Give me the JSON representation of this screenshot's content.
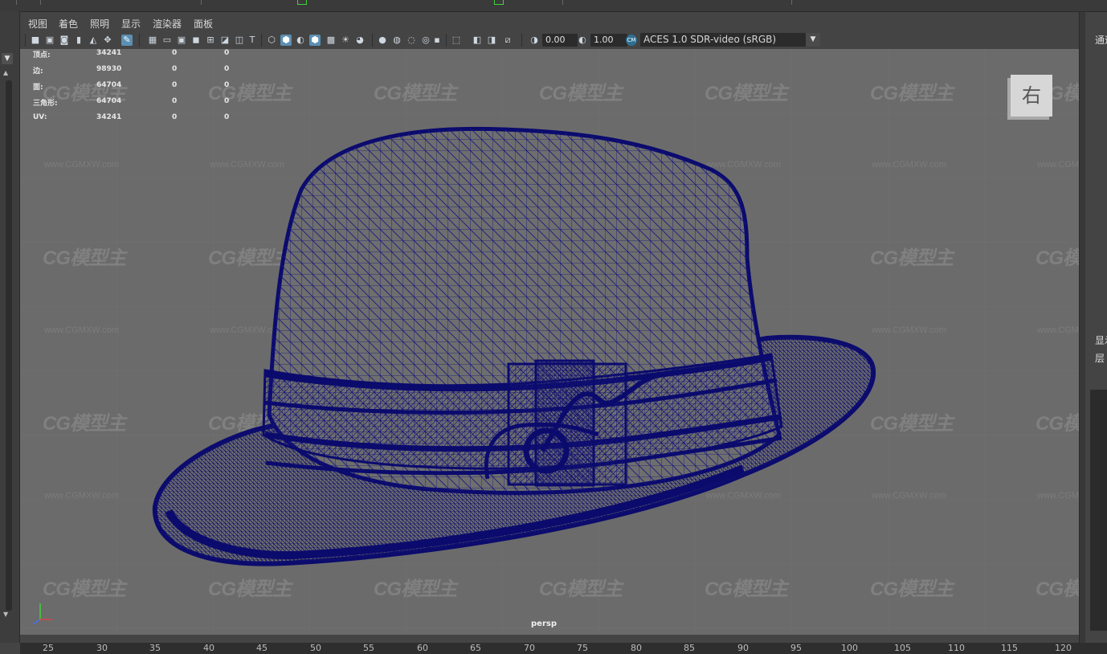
{
  "menu": [
    "视图",
    "着色",
    "照明",
    "显示",
    "渲染器",
    "面板"
  ],
  "toolbar": {
    "exposure": "0.00",
    "gamma": "1.00",
    "color_space": "ACES 1.0 SDR-video (sRGB)"
  },
  "hud": {
    "rows": [
      {
        "label": "顶点:",
        "c1": "34241",
        "c2": "0",
        "c3": "0"
      },
      {
        "label": "边:",
        "c1": "98930",
        "c2": "0",
        "c3": "0"
      },
      {
        "label": "面:",
        "c1": "64704",
        "c2": "0",
        "c3": "0"
      },
      {
        "label": "三角形:",
        "c1": "64704",
        "c2": "0",
        "c3": "0"
      },
      {
        "label": "UV:",
        "c1": "34241",
        "c2": "0",
        "c3": "0"
      }
    ]
  },
  "viewcube_label": "右",
  "camera_label": "persp",
  "watermark": {
    "logo": "CG模型主",
    "url": "www.CGMXW.com"
  },
  "right_panel": {
    "channel_tab": "通道",
    "display_tab": "显示",
    "layer_tab": "层"
  },
  "timeline": [
    "25",
    "30",
    "35",
    "40",
    "45",
    "50",
    "55",
    "60",
    "65",
    "70",
    "75",
    "80",
    "85",
    "90",
    "95",
    "100",
    "105",
    "110",
    "115",
    "120"
  ],
  "colors": {
    "wireframe": "#0d0d7a",
    "viewport_bg": "#6b6b6b",
    "ui_bg": "#444444"
  }
}
